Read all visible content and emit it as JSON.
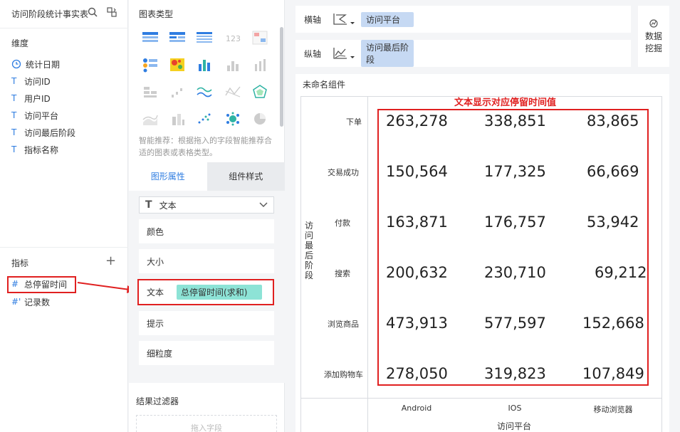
{
  "left": {
    "title": "访问阶段统计事实表",
    "dimensions_label": "维度",
    "dimensions": [
      {
        "icon": "clock-icon",
        "label": "统计日期"
      },
      {
        "icon": "text-type-icon",
        "label": "访问ID"
      },
      {
        "icon": "text-type-icon",
        "label": "用户ID"
      },
      {
        "icon": "text-type-icon",
        "label": "访问平台"
      },
      {
        "icon": "text-type-icon",
        "label": "访问最后阶段"
      },
      {
        "icon": "text-type-icon",
        "label": "指标名称"
      }
    ],
    "metrics_label": "指标",
    "metrics": [
      {
        "icon": "number-type-icon",
        "label": "总停留时间"
      },
      {
        "icon": "number-type-icon",
        "label": "记录数"
      }
    ]
  },
  "mid": {
    "chart_type_title": "图表类型",
    "hint": "智能推荐：根据拖入的字段智能推荐合适的图表或表格类型。",
    "tabs": [
      "图形属性",
      "组件样式"
    ],
    "select_value": "文本",
    "attrs": [
      "颜色",
      "大小",
      "文本",
      "提示",
      "细粒度"
    ],
    "text_field": "总停留时间(求和)",
    "filter_title": "结果过滤器",
    "drop_hint": "拖入字段"
  },
  "axes": {
    "x_label": "横轴",
    "x_field": "访问平台",
    "y_label": "纵轴",
    "y_field": "访问最后阶段"
  },
  "mining": "数据挖掘",
  "component": {
    "title": "未命名组件",
    "annotation": "文本显示对应停留时间值",
    "y_axis_title": "访问最后阶段",
    "x_axis_title": "访问平台",
    "rows": [
      "下单",
      "交易成功",
      "付款",
      "搜索",
      "浏览商品",
      "添加购物车"
    ],
    "cols": [
      "Android",
      "IOS",
      "移动浏览器"
    ],
    "values": [
      [
        "263,278",
        "338,851",
        "83,865"
      ],
      [
        "150,564",
        "177,325",
        "66,669"
      ],
      [
        "163,871",
        "176,757",
        "53,942"
      ],
      [
        "200,632",
        "230,710",
        "69,212"
      ],
      [
        "473,913",
        "577,597",
        "152,668"
      ],
      [
        "278,050",
        "319,823",
        "107,849"
      ]
    ]
  },
  "colors": {
    "accent": "#2f7de1",
    "annotation": "#e02020",
    "teal_pill": "#8de3d6",
    "blue_pill": "#c6d9f3"
  }
}
